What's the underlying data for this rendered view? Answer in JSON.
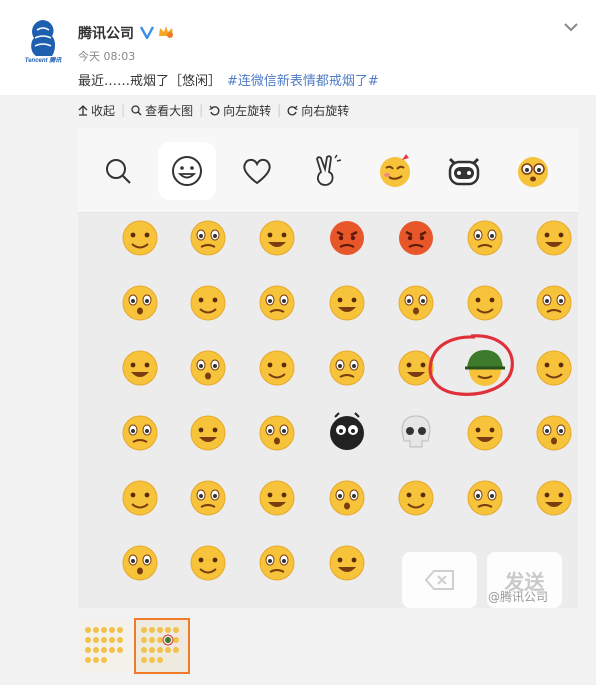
{
  "post": {
    "author": "腾讯公司",
    "time": "今天 08:03",
    "text": "最近……戒烟了［悠闲］",
    "hashtag": "#连微信新表情都戒烟了#",
    "avatar_logo_text": "Tencent 腾讯"
  },
  "toolbar": {
    "items": [
      {
        "icon": "arrow-up-icon",
        "label": "收起"
      },
      {
        "icon": "search-icon",
        "label": "查看大图"
      },
      {
        "icon": "rotate-left-icon",
        "label": "向左旋转"
      },
      {
        "icon": "rotate-right-icon",
        "label": "向右旋转"
      }
    ]
  },
  "keyboard": {
    "tabs": [
      "search-icon",
      "smiley-icon",
      "heart-icon",
      "peace-hand-icon",
      "emoji-pack-icon",
      "cow-sticker-icon",
      "emoji-pack-icon"
    ],
    "active_tab": 1,
    "send_label": "发送"
  },
  "watermark": "@腾讯公司",
  "colors": {
    "hashtag": "#4f7cc6",
    "circle": "#e0303a",
    "selected_thumb": "#f07c2a",
    "emoji_yellow": "#f7c33b"
  }
}
